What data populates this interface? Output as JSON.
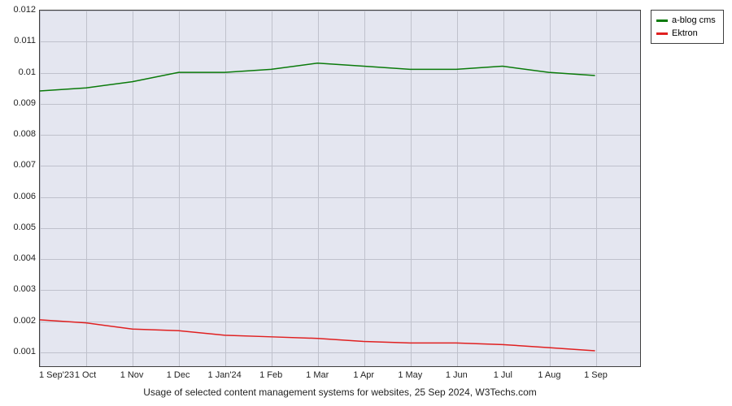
{
  "chart_data": {
    "type": "line",
    "title": "",
    "xlabel": "",
    "ylabel": "",
    "caption": "Usage of selected content management systems for websites, 25 Sep 2024, W3Techs.com",
    "ylim": [
      0.001,
      0.0125
    ],
    "y_ticks": [
      0.001,
      0.002,
      0.003,
      0.004,
      0.005,
      0.006,
      0.007,
      0.008,
      0.009,
      0.01,
      0.011,
      0.012
    ],
    "categories": [
      "1 Sep'23",
      "1 Oct",
      "1 Nov",
      "1 Dec",
      "1 Jan'24",
      "1 Feb",
      "1 Mar",
      "1 Apr",
      "1 May",
      "1 Jun",
      "1 Jul",
      "1 Aug",
      "1 Sep"
    ],
    "series": [
      {
        "name": "a-blog cms",
        "color": "#0a7a0a",
        "values": [
          0.0099,
          0.01,
          0.0102,
          0.0105,
          0.0105,
          0.0106,
          0.0108,
          0.0107,
          0.0106,
          0.0106,
          0.0107,
          0.0105,
          0.0104
        ]
      },
      {
        "name": "Ektron",
        "color": "#e02020",
        "values": [
          0.002,
          0.0019,
          0.0017,
          0.00165,
          0.0015,
          0.00145,
          0.0014,
          0.0013,
          0.00125,
          0.00125,
          0.0012,
          0.0011,
          0.001
        ]
      }
    ]
  }
}
